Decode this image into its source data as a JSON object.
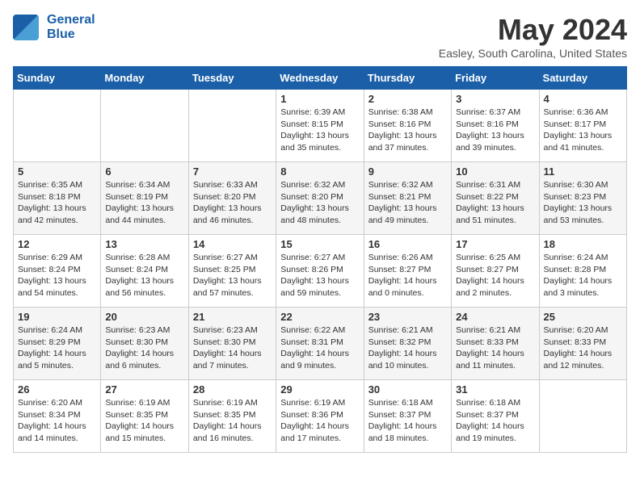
{
  "header": {
    "logo_line1": "General",
    "logo_line2": "Blue",
    "title": "May 2024",
    "location": "Easley, South Carolina, United States"
  },
  "days_of_week": [
    "Sunday",
    "Monday",
    "Tuesday",
    "Wednesday",
    "Thursday",
    "Friday",
    "Saturday"
  ],
  "weeks": [
    [
      {
        "day": "",
        "content": ""
      },
      {
        "day": "",
        "content": ""
      },
      {
        "day": "",
        "content": ""
      },
      {
        "day": "1",
        "content": "Sunrise: 6:39 AM\nSunset: 8:15 PM\nDaylight: 13 hours\nand 35 minutes."
      },
      {
        "day": "2",
        "content": "Sunrise: 6:38 AM\nSunset: 8:16 PM\nDaylight: 13 hours\nand 37 minutes."
      },
      {
        "day": "3",
        "content": "Sunrise: 6:37 AM\nSunset: 8:16 PM\nDaylight: 13 hours\nand 39 minutes."
      },
      {
        "day": "4",
        "content": "Sunrise: 6:36 AM\nSunset: 8:17 PM\nDaylight: 13 hours\nand 41 minutes."
      }
    ],
    [
      {
        "day": "5",
        "content": "Sunrise: 6:35 AM\nSunset: 8:18 PM\nDaylight: 13 hours\nand 42 minutes."
      },
      {
        "day": "6",
        "content": "Sunrise: 6:34 AM\nSunset: 8:19 PM\nDaylight: 13 hours\nand 44 minutes."
      },
      {
        "day": "7",
        "content": "Sunrise: 6:33 AM\nSunset: 8:20 PM\nDaylight: 13 hours\nand 46 minutes."
      },
      {
        "day": "8",
        "content": "Sunrise: 6:32 AM\nSunset: 8:20 PM\nDaylight: 13 hours\nand 48 minutes."
      },
      {
        "day": "9",
        "content": "Sunrise: 6:32 AM\nSunset: 8:21 PM\nDaylight: 13 hours\nand 49 minutes."
      },
      {
        "day": "10",
        "content": "Sunrise: 6:31 AM\nSunset: 8:22 PM\nDaylight: 13 hours\nand 51 minutes."
      },
      {
        "day": "11",
        "content": "Sunrise: 6:30 AM\nSunset: 8:23 PM\nDaylight: 13 hours\nand 53 minutes."
      }
    ],
    [
      {
        "day": "12",
        "content": "Sunrise: 6:29 AM\nSunset: 8:24 PM\nDaylight: 13 hours\nand 54 minutes."
      },
      {
        "day": "13",
        "content": "Sunrise: 6:28 AM\nSunset: 8:24 PM\nDaylight: 13 hours\nand 56 minutes."
      },
      {
        "day": "14",
        "content": "Sunrise: 6:27 AM\nSunset: 8:25 PM\nDaylight: 13 hours\nand 57 minutes."
      },
      {
        "day": "15",
        "content": "Sunrise: 6:27 AM\nSunset: 8:26 PM\nDaylight: 13 hours\nand 59 minutes."
      },
      {
        "day": "16",
        "content": "Sunrise: 6:26 AM\nSunset: 8:27 PM\nDaylight: 14 hours\nand 0 minutes."
      },
      {
        "day": "17",
        "content": "Sunrise: 6:25 AM\nSunset: 8:27 PM\nDaylight: 14 hours\nand 2 minutes."
      },
      {
        "day": "18",
        "content": "Sunrise: 6:24 AM\nSunset: 8:28 PM\nDaylight: 14 hours\nand 3 minutes."
      }
    ],
    [
      {
        "day": "19",
        "content": "Sunrise: 6:24 AM\nSunset: 8:29 PM\nDaylight: 14 hours\nand 5 minutes."
      },
      {
        "day": "20",
        "content": "Sunrise: 6:23 AM\nSunset: 8:30 PM\nDaylight: 14 hours\nand 6 minutes."
      },
      {
        "day": "21",
        "content": "Sunrise: 6:23 AM\nSunset: 8:30 PM\nDaylight: 14 hours\nand 7 minutes."
      },
      {
        "day": "22",
        "content": "Sunrise: 6:22 AM\nSunset: 8:31 PM\nDaylight: 14 hours\nand 9 minutes."
      },
      {
        "day": "23",
        "content": "Sunrise: 6:21 AM\nSunset: 8:32 PM\nDaylight: 14 hours\nand 10 minutes."
      },
      {
        "day": "24",
        "content": "Sunrise: 6:21 AM\nSunset: 8:33 PM\nDaylight: 14 hours\nand 11 minutes."
      },
      {
        "day": "25",
        "content": "Sunrise: 6:20 AM\nSunset: 8:33 PM\nDaylight: 14 hours\nand 12 minutes."
      }
    ],
    [
      {
        "day": "26",
        "content": "Sunrise: 6:20 AM\nSunset: 8:34 PM\nDaylight: 14 hours\nand 14 minutes."
      },
      {
        "day": "27",
        "content": "Sunrise: 6:19 AM\nSunset: 8:35 PM\nDaylight: 14 hours\nand 15 minutes."
      },
      {
        "day": "28",
        "content": "Sunrise: 6:19 AM\nSunset: 8:35 PM\nDaylight: 14 hours\nand 16 minutes."
      },
      {
        "day": "29",
        "content": "Sunrise: 6:19 AM\nSunset: 8:36 PM\nDaylight: 14 hours\nand 17 minutes."
      },
      {
        "day": "30",
        "content": "Sunrise: 6:18 AM\nSunset: 8:37 PM\nDaylight: 14 hours\nand 18 minutes."
      },
      {
        "day": "31",
        "content": "Sunrise: 6:18 AM\nSunset: 8:37 PM\nDaylight: 14 hours\nand 19 minutes."
      },
      {
        "day": "",
        "content": ""
      }
    ]
  ]
}
